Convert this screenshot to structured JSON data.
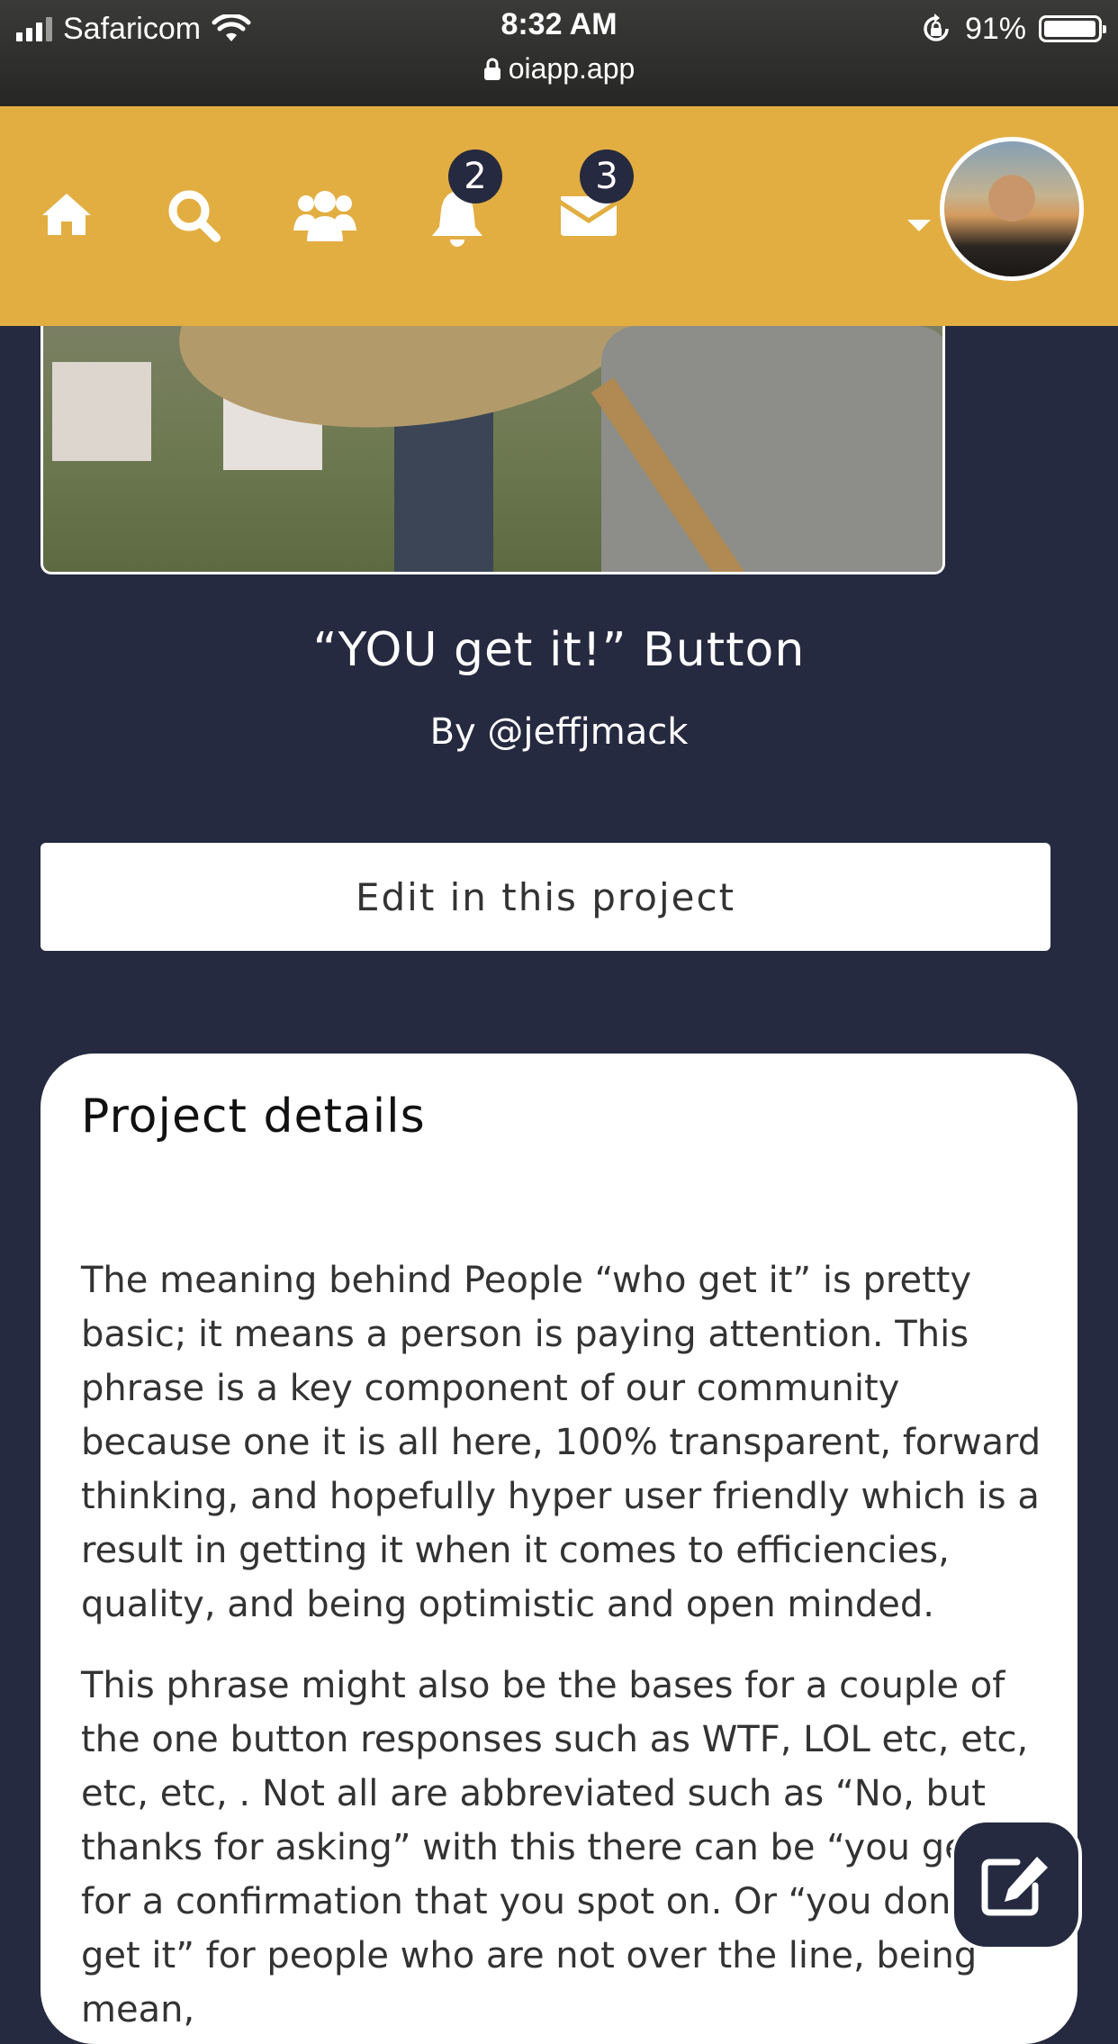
{
  "status_bar": {
    "carrier": "Safaricom",
    "time": "8:32 AM",
    "url": "oiapp.app",
    "battery": "91%",
    "battery_level": 0.91
  },
  "nav": {
    "items": [
      {
        "name": "home-icon"
      },
      {
        "name": "search-icon"
      },
      {
        "name": "users-icon"
      },
      {
        "name": "bell-icon",
        "badge": "2"
      },
      {
        "name": "envelope-icon",
        "badge": "3"
      }
    ],
    "colors": {
      "bar": "#e2ae42",
      "badge": "#262a40",
      "page": "#262a40"
    }
  },
  "project": {
    "title": "“YOU get it!” Button",
    "byline": "By @jeffjmack",
    "edit_button": "Edit in this project"
  },
  "details": {
    "heading": "Project details",
    "paragraphs": [
      "The meaning behind People “who get it” is pretty basic; it means a person is paying attention. This phrase is a key component of our community because one it is all here, 100% transparent, forward thinking, and hopefully hyper user friendly which is a result in getting it when it comes to efficiencies, quality, and being optimistic and open minded.",
      "This phrase might also be the bases for a couple of the one button responses such as WTF, LOL etc, etc, etc, etc, . Not all are abbreviated such as “No, but thanks for asking” with this there can be “you get it” for a confirmation that you spot on. Or “you don’t get it” for people who are not over the line, being mean,"
    ]
  },
  "fab": {
    "icon": "edit-icon"
  }
}
